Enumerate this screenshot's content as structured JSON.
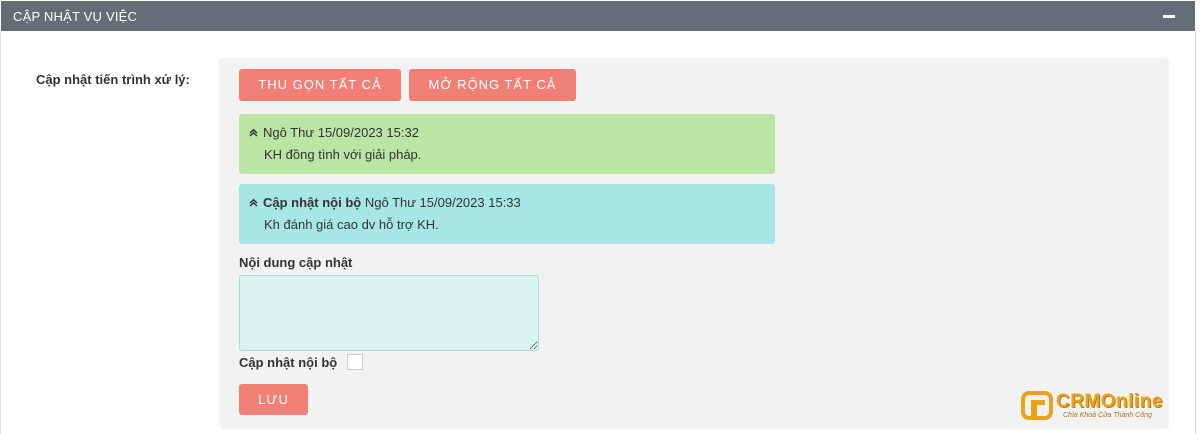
{
  "header": {
    "title": "CẬP NHẬT VỤ VIỆC",
    "collapse_icon": "minus-icon"
  },
  "form": {
    "label": "Cập nhật tiến trình xử lý:"
  },
  "buttons": {
    "collapse_all": "THU GỌN TẤT CẢ",
    "expand_all": "MỞ RỘNG TẤT CẢ",
    "save": "LƯU"
  },
  "notes": [
    {
      "prefix": "",
      "author_time": "Ngô Thư 15/09/2023 15:32",
      "content": "KH đồng tình với giải pháp.",
      "color": "#bae5a4"
    },
    {
      "prefix": "Cập nhật nội bộ",
      "author_time": "Ngô Thư 15/09/2023 15:33",
      "content": "Kh đánh giá cao dv hỗ trợ KH.",
      "color": "#a6e6e7"
    }
  ],
  "update_field": {
    "label": "Nội dung cập nhật",
    "value": ""
  },
  "internal_checkbox": {
    "label": "Cập nhật nội bộ",
    "checked": false
  },
  "brand": {
    "name": "CRMOnline",
    "tagline": "Chìa Khoá Cửa Thành Công"
  },
  "colors": {
    "header_bg": "#636e78",
    "button": "#f08076",
    "note_green": "#bae5a4",
    "note_cyan": "#a6e6e7",
    "textarea_bg": "#d9f4ee"
  }
}
